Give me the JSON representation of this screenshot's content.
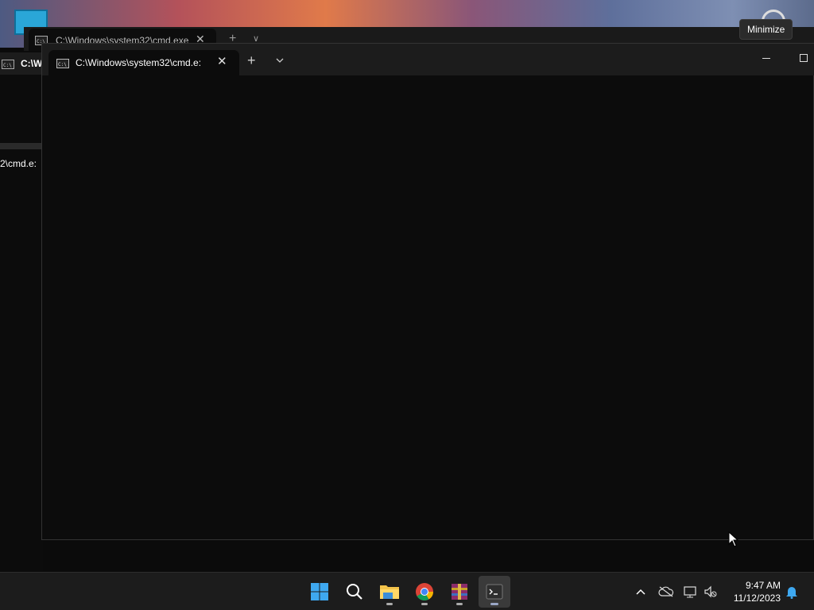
{
  "back_window": {
    "tab_title": "C:\\Windows\\system32\\cmd.exe",
    "tab_title_truncated": "C:\\Windows\\system32\\cmd.e:"
  },
  "left_window": {
    "title": "C:\\W",
    "subtitle": "2\\cmd.e:"
  },
  "main_window": {
    "tab_title": "C:\\Windows\\system32\\cmd.e:",
    "new_tab_label": "+",
    "close_tab_label": "✕"
  },
  "tooltip": {
    "text": "Minimize"
  },
  "taskbar": {
    "pinned": [
      {
        "name": "start",
        "icon": "windows-logo-icon"
      },
      {
        "name": "search",
        "icon": "search-icon"
      },
      {
        "name": "file-explorer",
        "icon": "folder-icon"
      },
      {
        "name": "chrome",
        "icon": "chrome-icon"
      },
      {
        "name": "winrar",
        "icon": "winrar-icon"
      },
      {
        "name": "terminal",
        "icon": "terminal-icon",
        "active": true
      }
    ],
    "time": "9:47 AM",
    "date": "11/12/2023"
  },
  "colors": {
    "accent": "#0078d4",
    "console_bg": "#0c0c0c",
    "titlebar_bg": "#1c1c1c",
    "taskbar_bg": "#1c1c1c"
  }
}
